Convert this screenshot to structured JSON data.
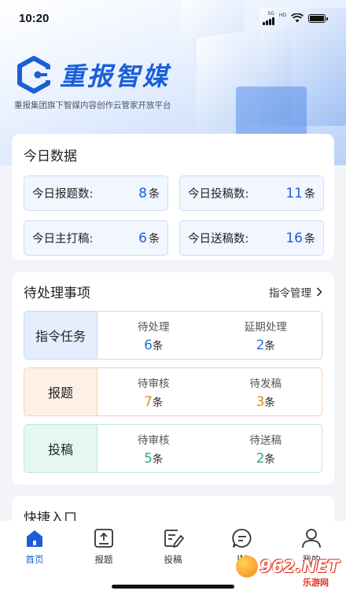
{
  "status_bar": {
    "time": "10:20",
    "network": "5G",
    "network_sub": "HD"
  },
  "header": {
    "app_name": "重报智媒",
    "tagline": "重报集团旗下智媒内容创作云管家开放平台"
  },
  "today": {
    "title": "今日数据",
    "unit": "条",
    "stats": [
      {
        "label": "今日报题数:",
        "value": "8"
      },
      {
        "label": "今日投稿数:",
        "value": "11"
      },
      {
        "label": "今日主打稿:",
        "value": "6"
      },
      {
        "label": "今日送稿数:",
        "value": "16"
      }
    ]
  },
  "pending": {
    "title": "待处理事项",
    "manage_label": "指令管理",
    "unit": "条",
    "rows": [
      {
        "name": "指令任务",
        "cells": [
          {
            "label": "待处理",
            "value": "6"
          },
          {
            "label": "延期处理",
            "value": "2"
          }
        ]
      },
      {
        "name": "报题",
        "cells": [
          {
            "label": "待审核",
            "value": "7"
          },
          {
            "label": "待发稿",
            "value": "3"
          }
        ]
      },
      {
        "name": "投稿",
        "cells": [
          {
            "label": "待审核",
            "value": "5"
          },
          {
            "label": "待送稿",
            "value": "2"
          }
        ]
      }
    ]
  },
  "shortcut": {
    "title": "快捷入口"
  },
  "tabbar": {
    "items": [
      {
        "label": "首页",
        "icon": "home-icon",
        "active": true
      },
      {
        "label": "报题",
        "icon": "upload-icon"
      },
      {
        "label": "投稿",
        "icon": "edit-document-icon"
      },
      {
        "label": "IM",
        "icon": "chat-icon"
      },
      {
        "label": "我的",
        "icon": "user-icon"
      }
    ]
  },
  "watermark": {
    "text": "962.NET",
    "sub": "乐游网"
  },
  "colors": {
    "brand": "#1a5fd8",
    "task_blue_bg": "#e4eefc",
    "task_blue_num": "#2a6fd6",
    "task_orange_bg": "#fdf0e6",
    "task_orange_num": "#e08a1e",
    "task_teal_bg": "#e4f7f2",
    "task_teal_num": "#2aa98a"
  }
}
